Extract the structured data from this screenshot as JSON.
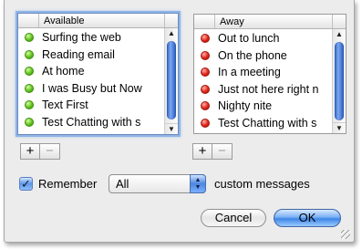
{
  "available_list": {
    "header": "Available",
    "items": [
      {
        "label": "Surfing the web",
        "status": "green"
      },
      {
        "label": "Reading email",
        "status": "green"
      },
      {
        "label": "At home",
        "status": "green"
      },
      {
        "label": "I was Busy but Now",
        "status": "green"
      },
      {
        "label": "Text First",
        "status": "green"
      },
      {
        "label": "Test Chatting with s",
        "status": "green"
      }
    ]
  },
  "away_list": {
    "header": "Away",
    "items": [
      {
        "label": "Out to lunch",
        "status": "red"
      },
      {
        "label": "On the phone",
        "status": "red"
      },
      {
        "label": "In a meeting",
        "status": "red"
      },
      {
        "label": "Just not here right n",
        "status": "red"
      },
      {
        "label": "Nighty nite",
        "status": "red"
      },
      {
        "label": "Test Chatting with s",
        "status": "red"
      }
    ]
  },
  "buttons": {
    "add": "+",
    "remove": "−",
    "cancel": "Cancel",
    "ok": "OK"
  },
  "remember": {
    "checked": true,
    "check_glyph": "✓",
    "label": "Remember",
    "select_value": "All",
    "suffix": "custom messages"
  },
  "colors": {
    "available_dot": "#62c31f",
    "away_dot": "#e0261a",
    "accent": "#3e86e8"
  },
  "icons": {
    "scroll_up": "▲",
    "scroll_down": "▼",
    "popup_arrows": "▲▼"
  }
}
